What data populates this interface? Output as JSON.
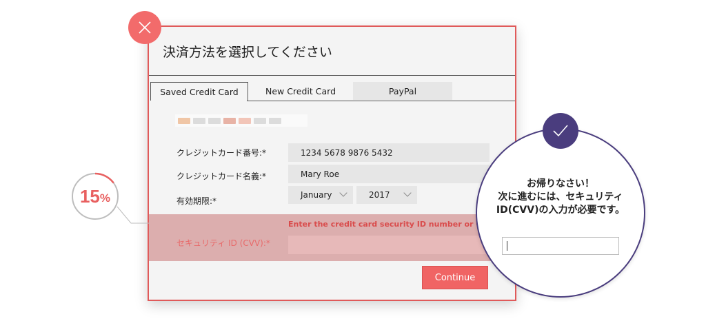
{
  "dialog": {
    "title": "決済方法を選択してください",
    "tabs": [
      {
        "label": "Saved Credit Card",
        "active": true
      },
      {
        "label": "New Credit Card",
        "active": false
      },
      {
        "label": "PayPal",
        "active": false
      }
    ],
    "fields": {
      "card_number_label": "クレジットカード番号:*",
      "card_number_value": "1234 5678 9876 5432",
      "card_name_label": "クレジットカード名義:*",
      "card_name_value": "Mary Roe",
      "expiry_label": "有効期限:*",
      "expiry_month": "January",
      "expiry_year": "2017"
    },
    "cvv": {
      "error": "Enter the credit card security ID number or CVV",
      "label": "セキュリティ ID (CVV):*",
      "value": ""
    },
    "continue_label": "Continue"
  },
  "progress": {
    "number": "15",
    "unit": "%",
    "value": 15
  },
  "welcome": {
    "line1": "お帰りなさい！",
    "line2": "次に進むには、セキュリティ",
    "line3": "ID(CVV)の入力が必要です。",
    "input_value": ""
  },
  "colors": {
    "accent_red": "#f26b6b",
    "accent_purple": "#4a3d7e"
  }
}
